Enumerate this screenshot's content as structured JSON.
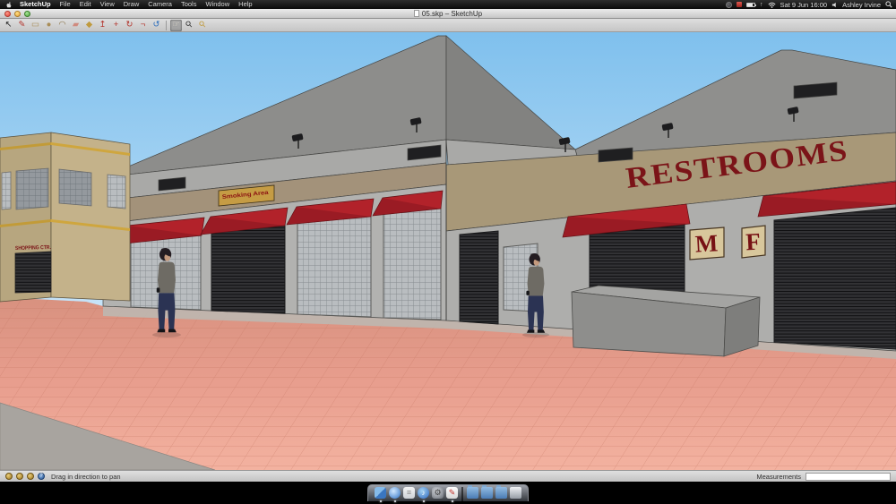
{
  "menu_bar": {
    "menus": [
      {
        "label": "SketchUp",
        "cls": "app-menu",
        "name": "menu-sketchup"
      },
      {
        "label": "File",
        "name": "menu-file"
      },
      {
        "label": "Edit",
        "name": "menu-edit"
      },
      {
        "label": "View",
        "name": "menu-view"
      },
      {
        "label": "Draw",
        "name": "menu-draw"
      },
      {
        "label": "Camera",
        "name": "menu-camera"
      },
      {
        "label": "Tools",
        "name": "menu-tools"
      },
      {
        "label": "Window",
        "name": "menu-window"
      },
      {
        "label": "Help",
        "name": "menu-help"
      }
    ],
    "date_time": "Sat 9 Jun 16:00",
    "user_name": "Ashley Irvine"
  },
  "window": {
    "title": "05.skp – SketchUp"
  },
  "toolbar": {
    "tools": [
      {
        "name": "select-tool",
        "glyph": "↖",
        "color": "#1a1a1a"
      },
      {
        "name": "line-tool",
        "glyph": "✎",
        "color": "#b3342c"
      },
      {
        "name": "rectangle-tool",
        "glyph": "▭",
        "color": "#a98d58"
      },
      {
        "name": "circle-tool",
        "glyph": "●",
        "color": "#a98d58"
      },
      {
        "name": "arc-tool",
        "glyph": "◠",
        "color": "#8a7448"
      },
      {
        "name": "eraser-tool",
        "glyph": "▰",
        "color": "#d08a7e"
      },
      {
        "name": "paint-bucket-tool",
        "glyph": "◆",
        "color": "#c09a3e"
      },
      {
        "name": "push-pull-tool",
        "glyph": "↥",
        "color": "#b3342c"
      },
      {
        "name": "move-tool",
        "glyph": "+",
        "color": "#b3342c"
      },
      {
        "name": "rotate-tool",
        "glyph": "↻",
        "color": "#b3342c"
      },
      {
        "name": "offset-tool",
        "glyph": "¬",
        "color": "#b3342c"
      },
      {
        "name": "orbit-tool",
        "glyph": "↺",
        "color": "#2e6fbd"
      },
      {
        "name": "toolbar-separator",
        "glyph": "",
        "cls": "tool-sep"
      },
      {
        "name": "pan-tool",
        "glyph": "☞",
        "color": "#f3efe4",
        "cls": "active pan-glow"
      },
      {
        "name": "zoom-tool",
        "glyph": "⚲",
        "color": "#333333",
        "cls": "rot45"
      },
      {
        "name": "zoom-extents-tool",
        "glyph": "⚲",
        "color": "#c09a3e",
        "cls": "rot45"
      }
    ]
  },
  "scene": {
    "signs": {
      "restrooms": "RESTROOMS",
      "smoking_area": "Smoking Area",
      "mens": "M",
      "womens": "F",
      "left_building": "SHOPPING CTR."
    },
    "colors": {
      "sky_top": "#7fc0ed",
      "sky_horizon": "#f2f9fe",
      "awning_red": "#b2222a",
      "fascia_tan": "#a89878",
      "wall_gray": "#b2b2b0",
      "roof_gray": "#8d8d8b",
      "pavement_pink": "#e89e8e",
      "left_building_tan": "#c4b28a",
      "sign_red": "#7b1418"
    }
  },
  "status_bar": {
    "hint": "Drag in direction to pan",
    "help_glyph": "?",
    "measurements_label": "Measurements",
    "measurements_value": ""
  },
  "dock": {
    "items": [
      {
        "name": "dock-finder-icon",
        "cls": "di-finder running"
      },
      {
        "name": "dock-safari-icon",
        "cls": "di-safari running"
      },
      {
        "name": "dock-textedit-icon",
        "cls": "di-textedit"
      },
      {
        "name": "dock-itunes-icon",
        "cls": "di-itunes running"
      },
      {
        "name": "dock-sysprefs-icon",
        "cls": "di-sysprefs"
      },
      {
        "name": "dock-sketchup-icon",
        "cls": "di-sketchup running"
      },
      {
        "name": "dock-separator",
        "cls": "di-sep"
      },
      {
        "name": "dock-folder-icon-1",
        "cls": "di-folder"
      },
      {
        "name": "dock-folder-icon-2",
        "cls": "di-folder"
      },
      {
        "name": "dock-folder-icon-3",
        "cls": "di-folder"
      },
      {
        "name": "dock-trash-icon",
        "cls": "di-trash"
      }
    ]
  }
}
